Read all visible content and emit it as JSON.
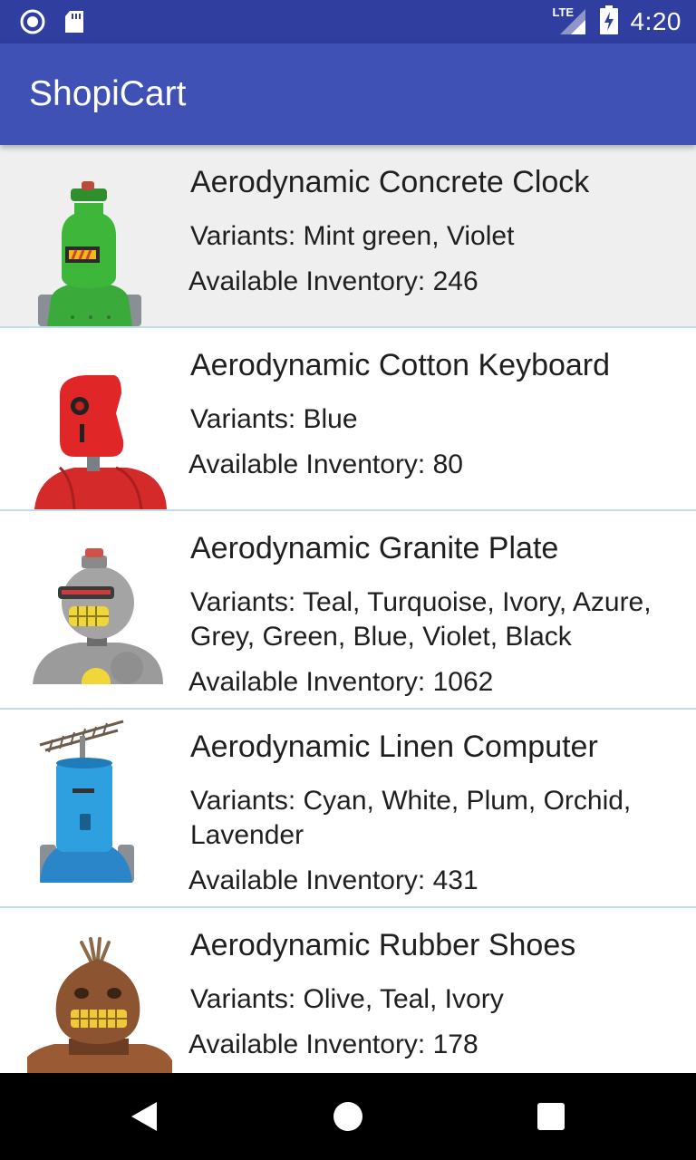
{
  "status_bar": {
    "time": "4:20",
    "network_label": "LTE",
    "icons": [
      "notification-circle-icon",
      "sd-card-icon",
      "lte-signal-icon",
      "battery-charging-icon"
    ]
  },
  "app_bar": {
    "title": "ShopiCart",
    "color": "#3f51b5"
  },
  "products": [
    {
      "name": "Aerodynamic Concrete Clock",
      "variants": "Variants: Mint green, Violet",
      "inventory": "Available Inventory: 246",
      "image": "green-robot-image",
      "selected": true
    },
    {
      "name": "Aerodynamic Cotton Keyboard",
      "variants": "Variants: Blue",
      "inventory": "Available Inventory: 80",
      "image": "red-robot-image",
      "selected": false
    },
    {
      "name": "Aerodynamic Granite Plate",
      "variants": "Variants: Teal, Turquoise, Ivory, Azure, Grey, Green, Blue, Violet, Black",
      "inventory": "Available Inventory: 1062",
      "image": "grey-robot-image",
      "selected": false
    },
    {
      "name": "Aerodynamic Linen Computer",
      "variants": "Variants: Cyan, White, Plum, Orchid, Lavender",
      "inventory": "Available Inventory: 431",
      "image": "blue-robot-image",
      "selected": false
    },
    {
      "name": "Aerodynamic Rubber Shoes",
      "variants": "Variants: Olive, Teal, Ivory",
      "inventory": "Available Inventory: 178",
      "image": "brown-robot-image",
      "selected": false
    }
  ],
  "nav_bar": {
    "buttons": [
      "back-icon",
      "home-icon",
      "recents-icon"
    ]
  }
}
